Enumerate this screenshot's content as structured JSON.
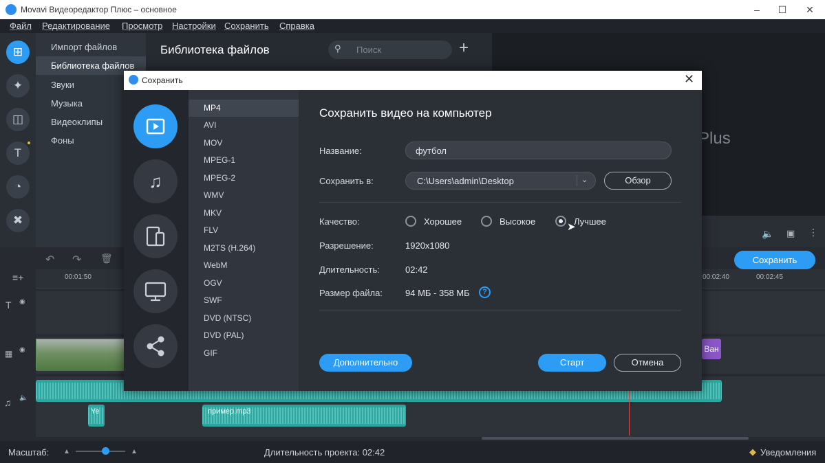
{
  "app": {
    "title": "Movavi Видеоредактор Плюс – основное"
  },
  "menu": [
    "Файл",
    "Редактирование",
    "Просмотр",
    "Настройки",
    "Сохранить",
    "Справка"
  ],
  "sidemenu": [
    "Импорт файлов",
    "Библиотека файлов",
    "Звуки",
    "Музыка",
    "Видеоклипы",
    "Фоны"
  ],
  "library": {
    "title": "Библиотека файлов",
    "search_placeholder": "Поиск"
  },
  "preview": {
    "ghost_text": "Plus"
  },
  "timeline": {
    "ruler": [
      "00:01:50",
      "00:02:40",
      "00:02:45"
    ],
    "clips": {
      "purple": "Ван",
      "audio_small": "Ye",
      "audio_mp3": "пример.mp3"
    }
  },
  "toolbar": {
    "save_button": "Сохранить"
  },
  "status": {
    "zoom_label": "Масштаб:",
    "duration": "Длительность проекта: 02:42",
    "notifications": "Уведомления"
  },
  "dialog": {
    "title": "Сохранить",
    "heading": "Сохранить видео на компьютер",
    "formats": [
      "MP4",
      "AVI",
      "MOV",
      "MPEG-1",
      "MPEG-2",
      "WMV",
      "MKV",
      "FLV",
      "M2TS (H.264)",
      "WebM",
      "OGV",
      "SWF",
      "DVD (NTSC)",
      "DVD (PAL)",
      "GIF"
    ],
    "selected_format": "MP4",
    "name_label": "Название:",
    "name_value": "футбол",
    "save_to_label": "Сохранить в:",
    "save_to_value": "C:\\Users\\admin\\Desktop",
    "browse": "Обзор",
    "quality_label": "Качество:",
    "quality_options": [
      "Хорошее",
      "Высокое",
      "Лучшее"
    ],
    "quality_selected": "Лучшее",
    "resolution_label": "Разрешение:",
    "resolution_value": "1920x1080",
    "duration_label": "Длительность:",
    "duration_value": "02:42",
    "filesize_label": "Размер файла:",
    "filesize_value": "94 МБ - 358 МБ",
    "advanced": "Дополнительно",
    "start": "Старт",
    "cancel": "Отмена"
  }
}
